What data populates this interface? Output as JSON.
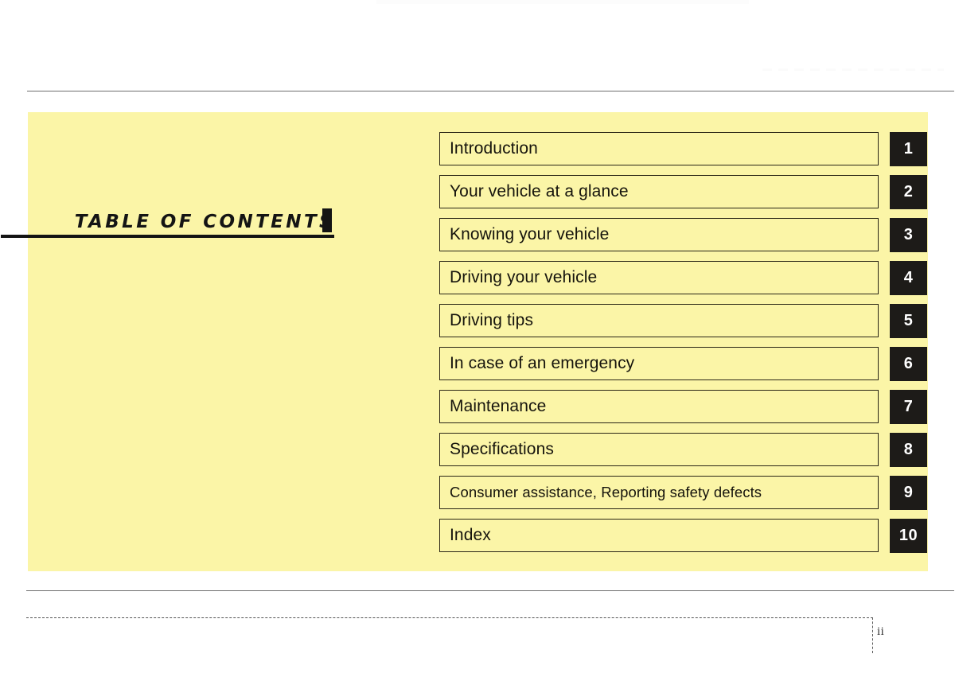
{
  "document": {
    "title": "TABLE OF CONTENTS",
    "page_number": "ii",
    "colors": {
      "panel_background": "#FBF5A7",
      "tab_background": "#1D1B18",
      "tab_text": "#FFFFFF",
      "body_text": "#16140D",
      "rule": "#6E6E6E"
    }
  },
  "contents": {
    "entries": [
      {
        "number": "1",
        "label": "Introduction"
      },
      {
        "number": "2",
        "label": "Your vehicle at a glance"
      },
      {
        "number": "3",
        "label": "Knowing your vehicle"
      },
      {
        "number": "4",
        "label": "Driving your vehicle"
      },
      {
        "number": "5",
        "label": "Driving tips"
      },
      {
        "number": "6",
        "label": "In case of an emergency"
      },
      {
        "number": "7",
        "label": "Maintenance"
      },
      {
        "number": "8",
        "label": "Specifications"
      },
      {
        "number": "9",
        "label": "Consumer assistance, Reporting safety defects"
      },
      {
        "number": "10",
        "label": "Index"
      }
    ]
  }
}
